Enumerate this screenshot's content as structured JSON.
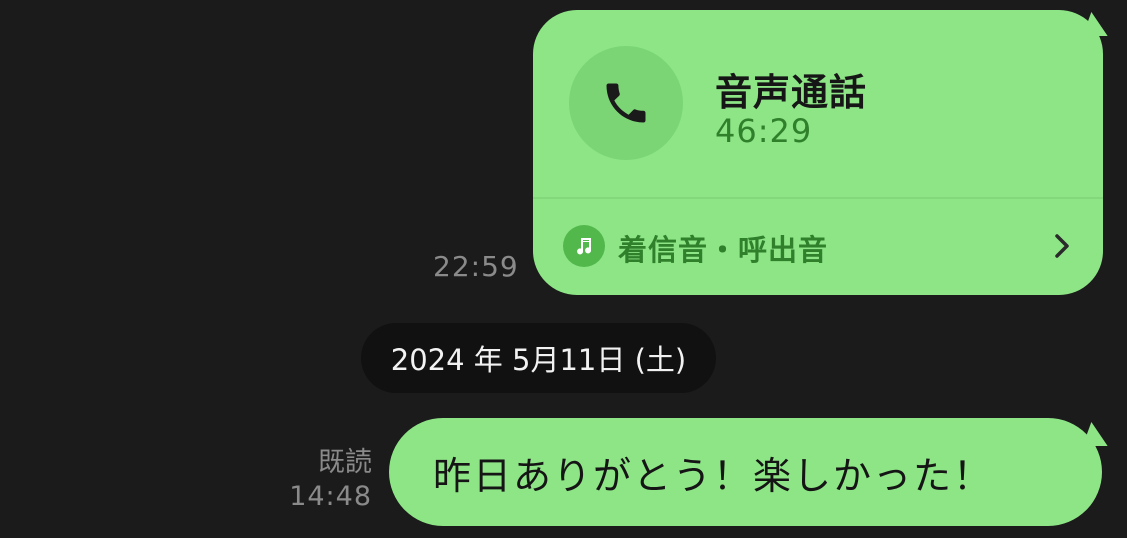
{
  "call_message": {
    "title": "音声通話",
    "duration": "46:29",
    "ringtone_label": "着信音・呼出音",
    "sent_time": "22:59",
    "icon": "phone-icon",
    "ringtone_icon": "music-note-icon",
    "chevron_icon": "chevron-right-icon"
  },
  "date_separator": {
    "label": "2024 年 5月11日 (土)"
  },
  "text_message": {
    "text": "昨日ありがとう！楽しかった！",
    "read_status": "既読",
    "sent_time": "14:48"
  },
  "colors": {
    "background": "#1b1b1b",
    "bubble": "#8de586",
    "accent_green": "#2f7f2b",
    "date_chip": "#111111"
  }
}
